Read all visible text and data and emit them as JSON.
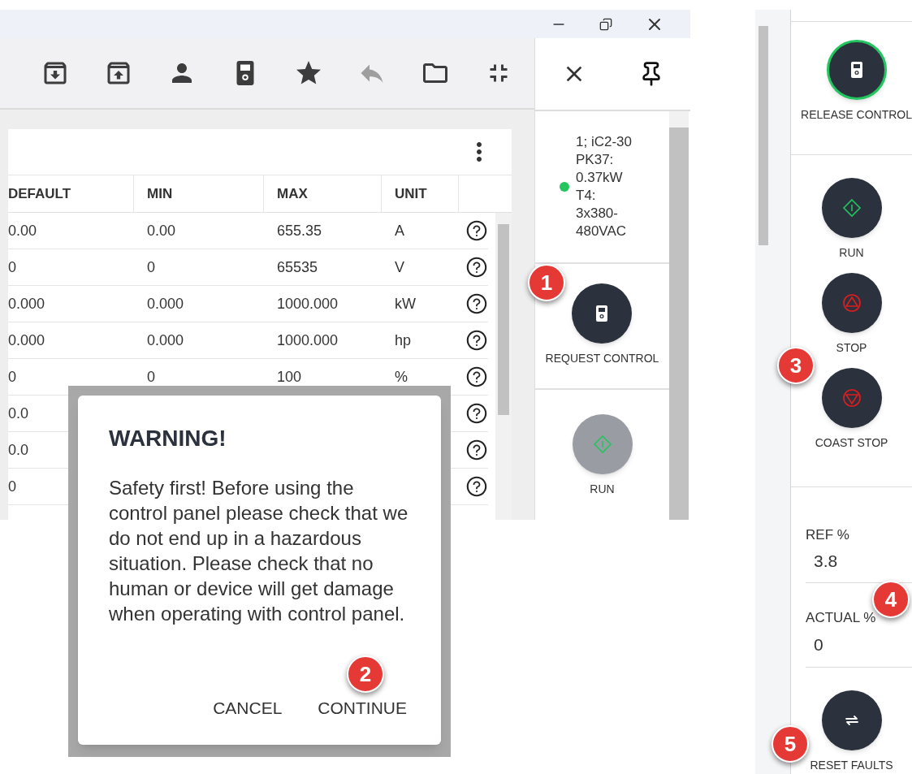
{
  "toolbar": {
    "items": [
      {
        "kind": "archive-down",
        "disabled": false
      },
      {
        "kind": "archive-up",
        "disabled": false
      },
      {
        "kind": "person",
        "disabled": false
      },
      {
        "kind": "remote",
        "disabled": false
      },
      {
        "kind": "star",
        "disabled": false
      },
      {
        "kind": "reply",
        "disabled": true
      },
      {
        "kind": "folder",
        "disabled": false
      },
      {
        "kind": "collapse",
        "disabled": false
      }
    ]
  },
  "table": {
    "columns": [
      "DEFAULT",
      "MIN",
      "MAX",
      "UNIT"
    ],
    "rows": [
      {
        "cells": [
          "0.00",
          "0.00",
          "655.35",
          "A"
        ]
      },
      {
        "cells": [
          "0",
          "0",
          "65535",
          "V"
        ]
      },
      {
        "cells": [
          "0.000",
          "0.000",
          "1000.000",
          "kW"
        ]
      },
      {
        "cells": [
          "0.000",
          "0.000",
          "1000.000",
          "hp"
        ]
      },
      {
        "cells": [
          "0",
          "0",
          "100",
          "%"
        ]
      },
      {
        "cells": [
          "0.0"
        ]
      },
      {
        "cells": [
          "0.0"
        ]
      },
      {
        "cells": [
          "0"
        ]
      }
    ]
  },
  "side_panel": {
    "device_info": "1; iC2-30 PK37: 0.37kW T4: 3x380-480VAC",
    "online": true,
    "actions": [
      {
        "kind": "control",
        "label": "REQUEST CONTROL",
        "disabled": false
      },
      {
        "kind": "run",
        "label": "RUN",
        "disabled": true
      }
    ]
  },
  "dialog": {
    "title": "WARNING!",
    "message": "Safety first! Before using the control panel please check that we do not end up in a hazardous situation. Please check that no human or device will get damage when operating with control panel.",
    "buttons": [
      "CANCEL",
      "CONTINUE"
    ]
  },
  "control_panel": {
    "control": {
      "label": "RELEASE CONTROL",
      "active": true
    },
    "commands": [
      {
        "kind": "run",
        "label": "RUN"
      },
      {
        "kind": "stop",
        "label": "STOP"
      },
      {
        "kind": "coast",
        "label": "COAST STOP"
      }
    ],
    "readouts": [
      {
        "label": "REF %",
        "value": "3.8"
      },
      {
        "label": "ACTUAL %",
        "value": "0"
      }
    ],
    "reset": {
      "label": "RESET FAULTS"
    }
  },
  "callouts": [
    "1",
    "2",
    "3",
    "4",
    "5"
  ]
}
